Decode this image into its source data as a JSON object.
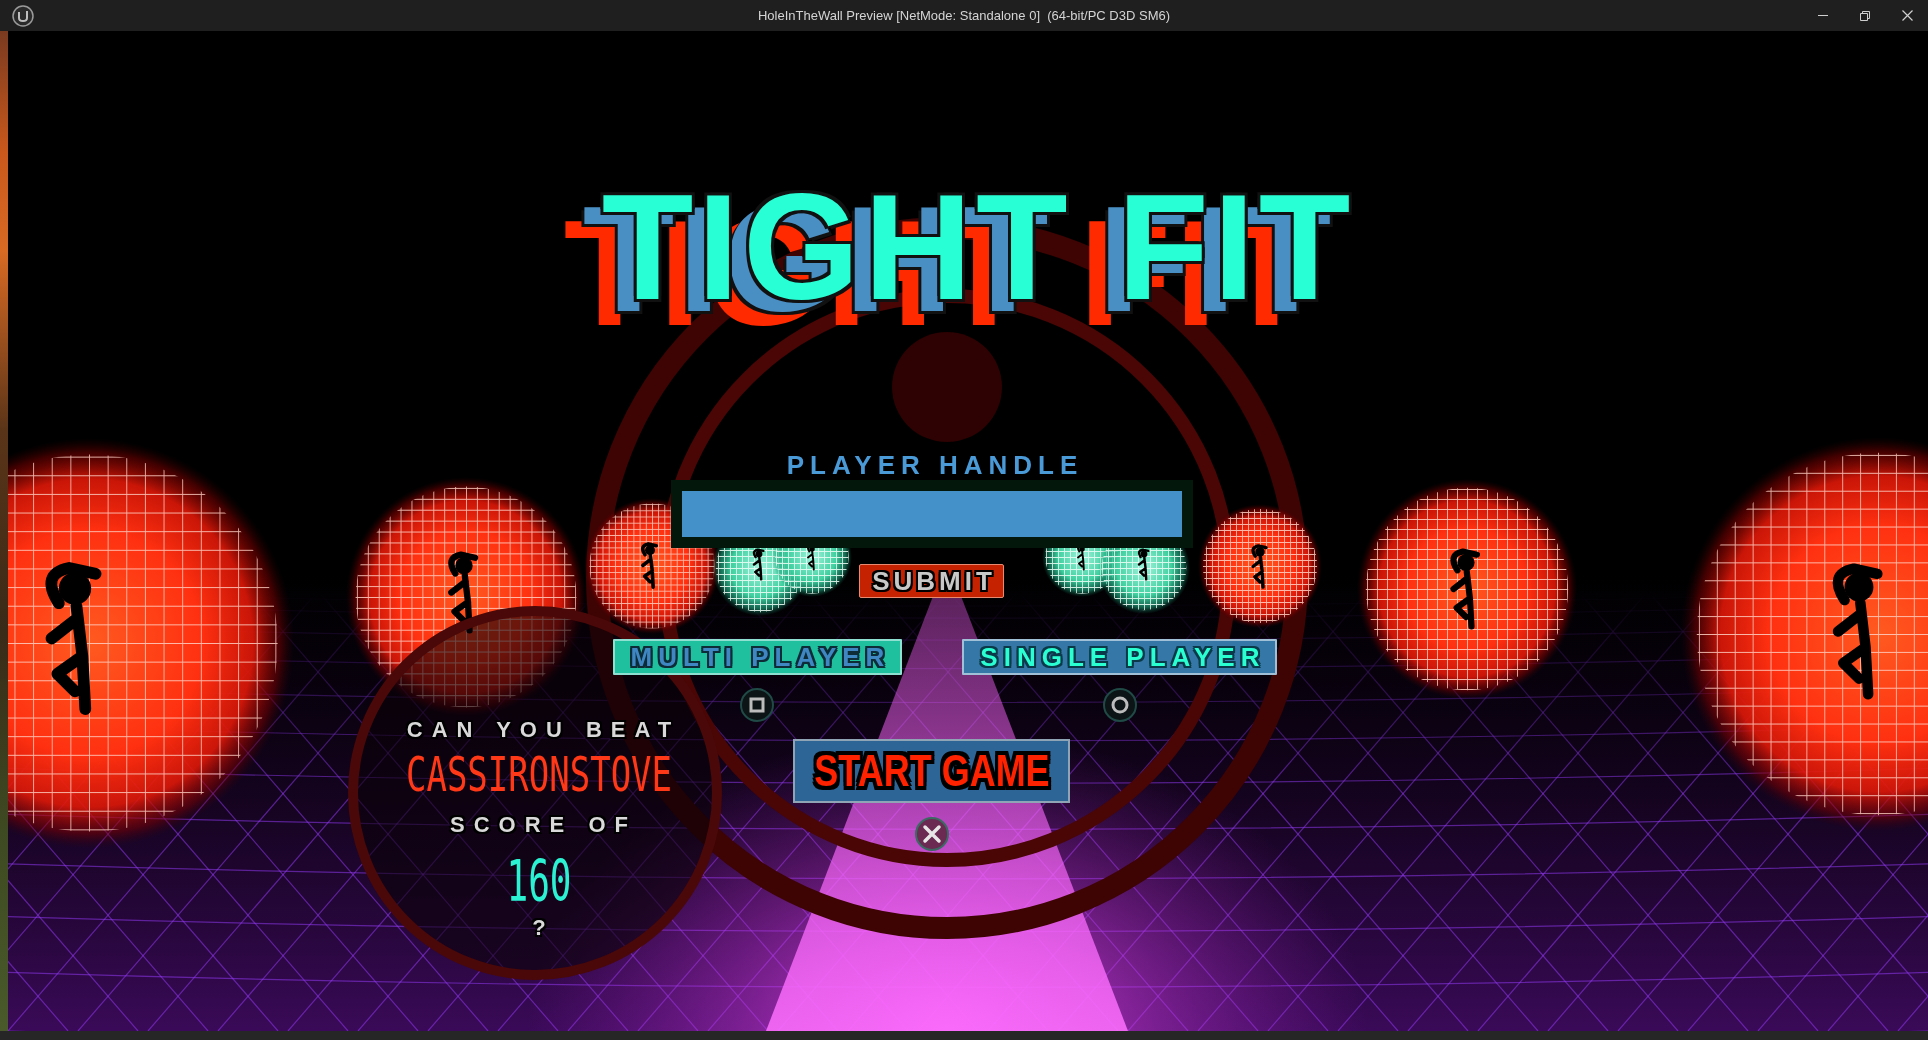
{
  "window": {
    "title": "HoleInTheWall Preview [NetMode: Standalone 0]  (64-bit/PC D3D SM6)"
  },
  "game_title": "TIGHT FIT",
  "player_handle": {
    "label": "PLAYER HANDLE",
    "submit": "SUBMIT"
  },
  "mode_buttons": [
    {
      "label": "MULTI PLAYER",
      "kind": "teal"
    },
    {
      "label": "SINGLE PLAYER",
      "kind": "blue"
    }
  ],
  "start_button": "START GAME",
  "challenge": {
    "intro": "CAN YOU BEAT",
    "player": "CASSIRONSTOVE",
    "score_label": "SCORE OF",
    "score": "160",
    "ending": "?"
  }
}
